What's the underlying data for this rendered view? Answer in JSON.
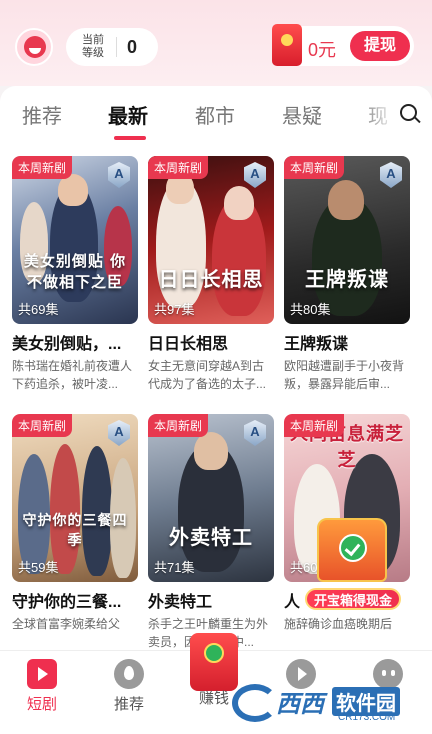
{
  "header": {
    "level_label": "当前等级",
    "level_value": "0",
    "balance": "0元",
    "withdraw_label": "提现"
  },
  "tabs": [
    "推荐",
    "最新",
    "都市",
    "悬疑",
    "现"
  ],
  "active_tab": "最新",
  "badge_new": "本周新剧",
  "badge_rating": "A",
  "cards": [
    {
      "poster_title": "美女别倒贴 你不做相下之臣",
      "episodes": "共69集",
      "title": "美女别倒贴，...",
      "desc": "陈书瑞在婚礼前夜遭人下药追杀，被叶凌..."
    },
    {
      "poster_title": "日日长相思",
      "episodes": "共97集",
      "title": "日日长相思",
      "desc": "女主无意间穿越A到古代成为了备选的太子..."
    },
    {
      "poster_title": "王牌叛谍",
      "episodes": "共80集",
      "title": "王牌叛谍",
      "desc": "欧阳越遭副手于小夜背叛，暴露异能后审..."
    },
    {
      "poster_title": "守护你的三餐四季",
      "episodes": "共59集",
      "title": "守护你的三餐...",
      "desc": "全球首富李婉柔给父"
    },
    {
      "poster_title": "外卖特工",
      "episodes": "共71集",
      "title": "外卖特工",
      "desc": "杀手之王叶麟重生为外卖员，因救洋芸中..."
    },
    {
      "poster_title": "人间苗息满芝芝",
      "episodes": "共60",
      "title": "人",
      "desc": "施辞确诊血癌晚期后"
    }
  ],
  "treasure_cta": "开宝箱得现金",
  "bottom_nav": [
    {
      "label": "短剧",
      "icon": "tv-icon"
    },
    {
      "label": "推荐",
      "icon": "fire-icon"
    },
    {
      "label": "赚钱",
      "icon": "red-packet-icon"
    },
    {
      "label": "",
      "icon": "play-icon"
    },
    {
      "label": "",
      "icon": "face-icon"
    }
  ],
  "watermark": {
    "name": "西西",
    "tag": "软件园",
    "url": "CR173.COM"
  },
  "colors": {
    "accent": "#ef2f4f",
    "header_bg": "#fbe3e8"
  }
}
